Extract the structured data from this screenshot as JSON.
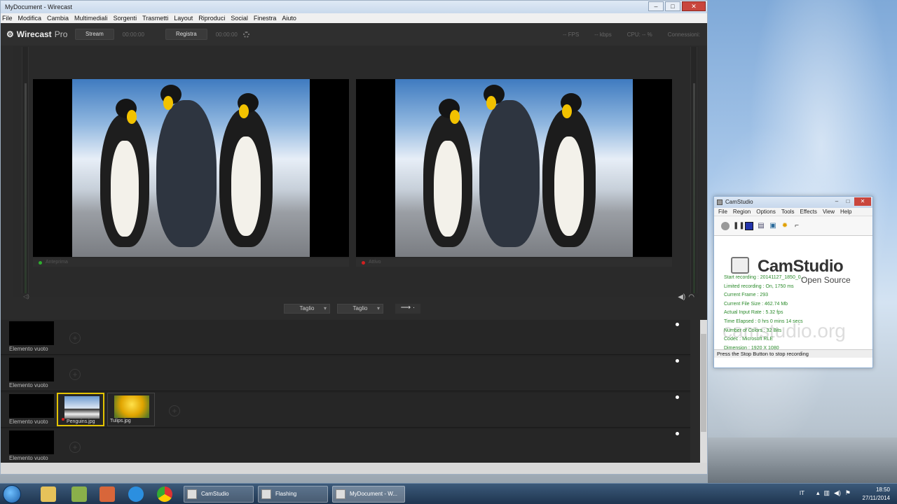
{
  "wirecast": {
    "window_title": "MyDocument - Wirecast",
    "menu": [
      "File",
      "Modifica",
      "Cambia",
      "Multimediali",
      "Sorgenti",
      "Trasmetti",
      "Layout",
      "Riproduci",
      "Social",
      "Finestra",
      "Aiuto"
    ],
    "brand": "Wirecast",
    "brand_suffix": "Pro",
    "stream_label": "Stream",
    "stream_time": "00:00:00",
    "record_label": "Registra",
    "record_time": "00:00:00",
    "fps": "-- FPS",
    "kbps": "-- kbps",
    "cpu": "CPU: -- %",
    "connections": "Connessioni:",
    "preview_label": "Anteprima",
    "live_label": "Attivo",
    "transition1": "Taglio",
    "transition2": "Taglio",
    "go_symbol": "⟶",
    "layers": [
      {
        "shot": "Elemento vuoto"
      },
      {
        "shot": "Elemento vuoto"
      },
      {
        "shot": "Elemento vuoto",
        "media": [
          "Penguins.jpg",
          "Tulips.jpg"
        ]
      },
      {
        "shot": "Elemento vuoto"
      }
    ],
    "colors": {
      "preview_dot": "#2fae2f",
      "live_dot": "#d22020",
      "selected_border": "#e3c300"
    }
  },
  "camstudio": {
    "window_title": "CamStudio",
    "menu": [
      "File",
      "Region",
      "Options",
      "Tools",
      "Effects",
      "View",
      "Help"
    ],
    "tools": [
      "record-icon",
      "pause-icon",
      "stop-icon",
      "options-icon",
      "video-icon",
      "effects-icon",
      "region-icon"
    ],
    "brand": "CamStudio",
    "brand_sub": "Open Source",
    "watermark": "camstudio.org",
    "stats": [
      "Start recording : 20141127_1850_0...",
      "Limited recording : On, 1750 ms",
      "Current Frame : 293",
      "Current File Size : 462.74 Mb",
      "Actual Input Rate : 5.32 fps",
      "Time Elapsed : 0 hrs 0 mins 14 secs",
      "Number of Colors : 32 Bits",
      "Codec : Microsoft RLE",
      "Dimension : 1920 X 1080"
    ],
    "status": "Press the Stop Button to stop recording"
  },
  "taskbar": {
    "tasks": [
      "CamStudio",
      "Flashing",
      "MyDocument - W..."
    ],
    "language": "IT",
    "time": "18:50",
    "date": "27/11/2014"
  }
}
